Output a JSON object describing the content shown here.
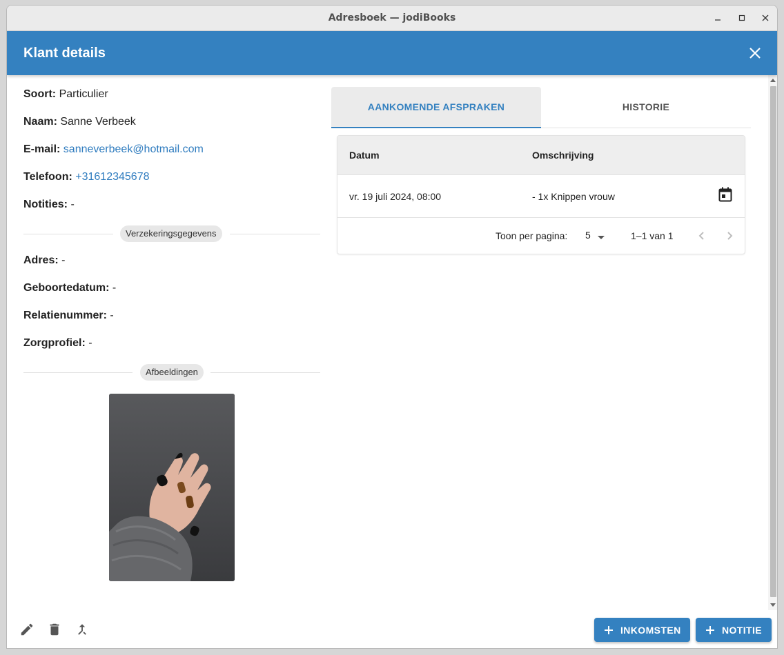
{
  "window": {
    "title": "Adresboek — jodiBooks"
  },
  "dialog": {
    "title": "Klant details"
  },
  "details": {
    "soort": {
      "label": "Soort:",
      "value": "Particulier"
    },
    "naam": {
      "label": "Naam:",
      "value": "Sanne Verbeek"
    },
    "email": {
      "label": "E-mail:",
      "value": "sanneverbeek@hotmail.com"
    },
    "telefoon": {
      "label": "Telefoon:",
      "value": "+31612345678"
    },
    "notities": {
      "label": "Notities:",
      "value": "-"
    },
    "insurance_section": "Verzekeringsgegevens",
    "adres": {
      "label": "Adres:",
      "value": "-"
    },
    "geboortedatum": {
      "label": "Geboortedatum:",
      "value": "-"
    },
    "relatienummer": {
      "label": "Relatienummer:",
      "value": "-"
    },
    "zorgprofiel": {
      "label": "Zorgprofiel:",
      "value": "-"
    },
    "images_section": "Afbeeldingen"
  },
  "tabs": [
    {
      "label": "AANKOMENDE AFSPRAKEN",
      "active": true
    },
    {
      "label": "HISTORIE",
      "active": false
    }
  ],
  "appointments": {
    "columns": [
      "Datum",
      "Omschrijving"
    ],
    "rows": [
      {
        "datum": "vr. 19 juli 2024, 08:00",
        "omschrijving": "- 1x Knippen vrouw",
        "icon": "calendar-icon"
      }
    ],
    "pager": {
      "per_page_label": "Toon per pagina:",
      "per_page_value": "5",
      "range": "1–1 van 1"
    }
  },
  "footer": {
    "icons": [
      "edit-icon",
      "delete-icon",
      "merge-icon"
    ],
    "buttons": [
      {
        "label": "INKOMSTEN",
        "icon": "plus-icon"
      },
      {
        "label": "NOTITIE",
        "icon": "plus-icon"
      }
    ]
  },
  "colors": {
    "primary": "#3481c0",
    "link": "#2f7cbf"
  }
}
